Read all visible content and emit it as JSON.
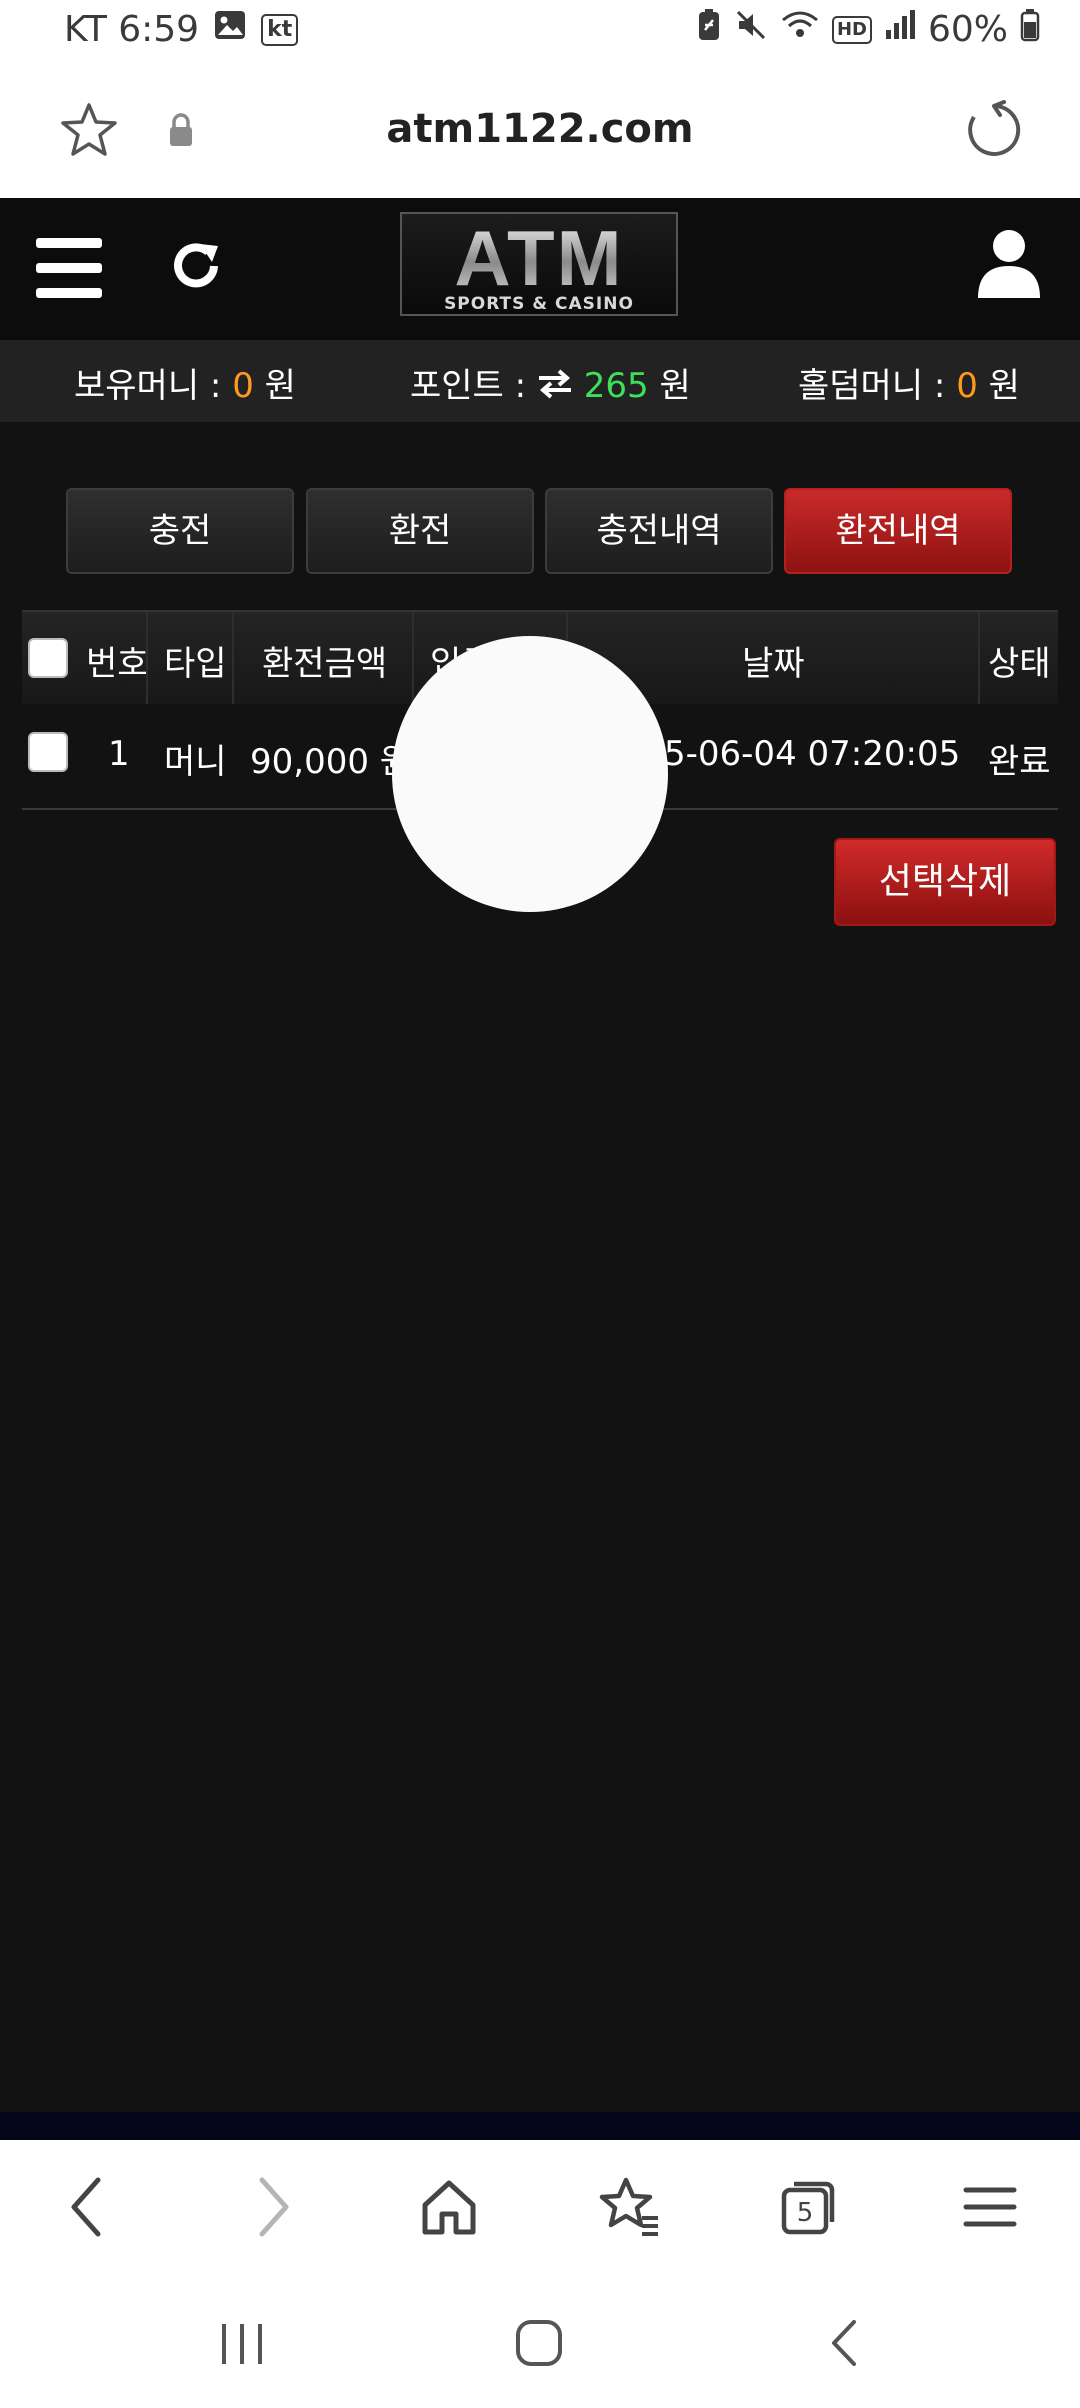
{
  "status_bar": {
    "carrier_time": "KT 6:59",
    "kt_badge": "kt",
    "battery": "60%",
    "icons": [
      "image-icon",
      "kt-icon",
      "battery-saver-icon",
      "mute-icon",
      "wifi-icon",
      "hd-icon",
      "signal-icon",
      "battery-icon"
    ]
  },
  "browser": {
    "url": "atm1122.com",
    "tab_count": "5"
  },
  "header": {
    "logo_main": "ATM",
    "logo_sub": "SPORTS & CASINO"
  },
  "money_bar": {
    "holding_label": "보유머니 : ",
    "holding_value": "0",
    "holding_unit": " 원",
    "point_label": "포인트 : ",
    "point_value": "265",
    "point_unit": " 원",
    "holdem_label": "홀덤머니 : ",
    "holdem_value": "0",
    "holdem_unit": " 원",
    "colors": {
      "orange": "#ff9a1f",
      "green": "#3ee05a"
    }
  },
  "tabs": [
    {
      "label": "충전"
    },
    {
      "label": "환전"
    },
    {
      "label": "충전내역"
    },
    {
      "label": "환전내역",
      "active": true
    }
  ],
  "table": {
    "headers": [
      "번호",
      "타입",
      "환전금액",
      "입금",
      "날짜",
      "상태"
    ],
    "rows": [
      {
        "no": "1",
        "type": "머니",
        "amount": "90,000 원",
        "date": "5-06-04 07:20:05",
        "status": "완료"
      }
    ]
  },
  "delete_button": "선택삭제",
  "accent_color": "#c92a2a"
}
